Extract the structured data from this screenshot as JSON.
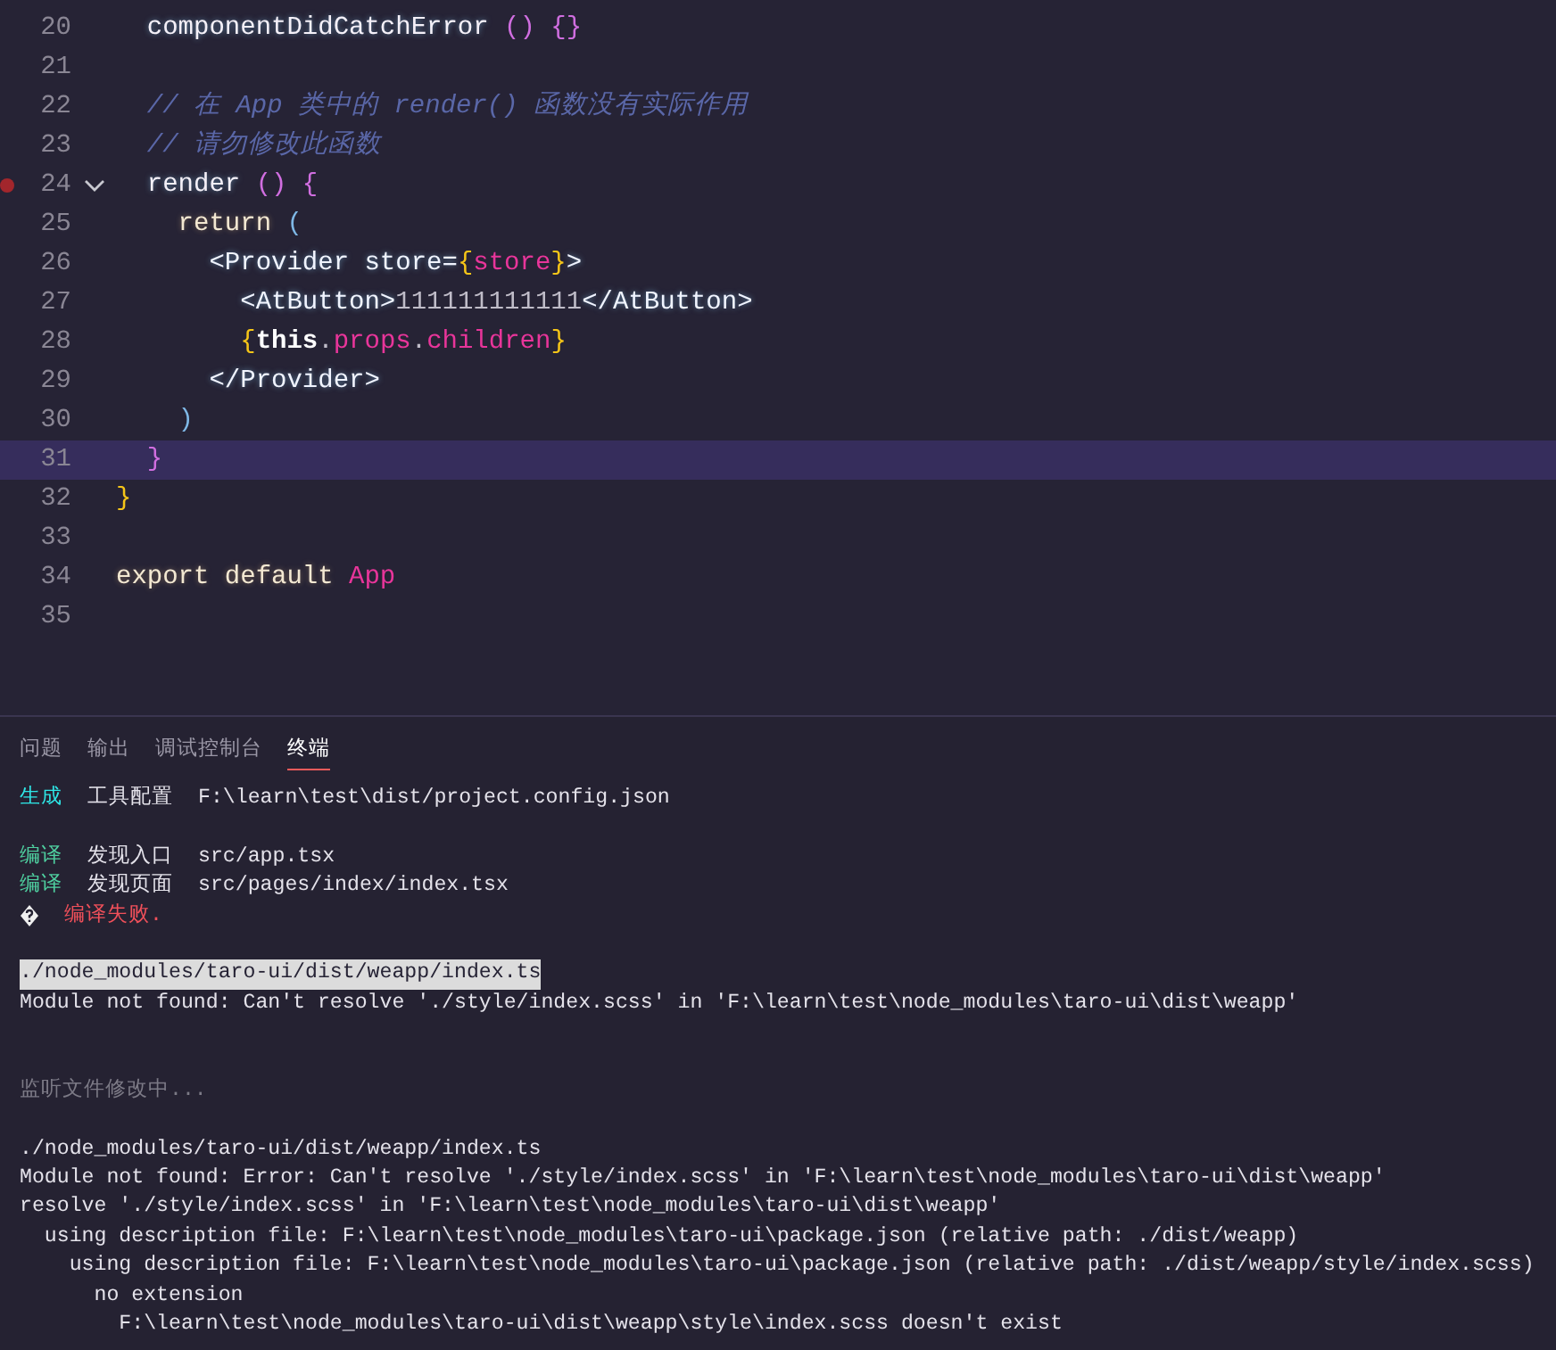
{
  "editor": {
    "lines": [
      {
        "number": "20",
        "breakpoint": false,
        "fold": false,
        "current": false,
        "tokens": [
          {
            "text": "  componentDidCatchError ",
            "kind": "plain"
          },
          {
            "text": "() {}",
            "kind": "paren"
          }
        ]
      },
      {
        "number": "21",
        "breakpoint": false,
        "fold": false,
        "current": false
      },
      {
        "number": "22",
        "breakpoint": false,
        "fold": false,
        "current": false,
        "tokens": [
          {
            "text": "  // 在 App 类中的 render() 函数没有实际作用",
            "kind": "comment"
          }
        ]
      },
      {
        "number": "23",
        "breakpoint": false,
        "fold": false,
        "current": false,
        "tokens": [
          {
            "text": "  // 请勿修改此函数",
            "kind": "comment"
          }
        ]
      },
      {
        "number": "24",
        "breakpoint": true,
        "fold": true,
        "current": false,
        "tokens": [
          {
            "text": "  render ",
            "kind": "plain"
          },
          {
            "text": "() {",
            "kind": "paren"
          }
        ]
      },
      {
        "number": "25",
        "breakpoint": false,
        "fold": false,
        "current": false,
        "tokens": [
          {
            "text": "    return ",
            "kind": "keyword"
          },
          {
            "text": "(",
            "kind": "blue"
          }
        ]
      },
      {
        "number": "26",
        "breakpoint": false,
        "fold": false,
        "current": false,
        "tokens": [
          {
            "text": "      <Provider store=",
            "kind": "tag"
          },
          {
            "text": "{",
            "kind": "brace"
          },
          {
            "text": "store",
            "kind": "prop"
          },
          {
            "text": "}",
            "kind": "brace"
          },
          {
            "text": ">",
            "kind": "tag"
          }
        ]
      },
      {
        "number": "27",
        "breakpoint": false,
        "fold": false,
        "current": false,
        "tokens": [
          {
            "text": "        <AtButton>",
            "kind": "tag"
          },
          {
            "text": "111111111111",
            "kind": "text"
          },
          {
            "text": "</AtButton>",
            "kind": "tag"
          }
        ]
      },
      {
        "number": "28",
        "breakpoint": false,
        "fold": false,
        "current": false,
        "tokens": [
          {
            "text": "        {",
            "kind": "brace"
          },
          {
            "text": "this",
            "kind": "bold"
          },
          {
            "text": ".",
            "kind": "text"
          },
          {
            "text": "props",
            "kind": "prop"
          },
          {
            "text": ".",
            "kind": "text"
          },
          {
            "text": "children",
            "kind": "prop"
          },
          {
            "text": "}",
            "kind": "brace"
          }
        ]
      },
      {
        "number": "29",
        "breakpoint": false,
        "fold": false,
        "current": false,
        "tokens": [
          {
            "text": "      </Provider>",
            "kind": "tag"
          }
        ]
      },
      {
        "number": "30",
        "breakpoint": false,
        "fold": false,
        "current": false,
        "tokens": [
          {
            "text": "    )",
            "kind": "blue"
          }
        ]
      },
      {
        "number": "31",
        "breakpoint": false,
        "fold": false,
        "current": true,
        "tokens": [
          {
            "text": "  }",
            "kind": "paren"
          }
        ]
      },
      {
        "number": "32",
        "breakpoint": false,
        "fold": false,
        "current": false,
        "tokens": [
          {
            "text": "}",
            "kind": "brace"
          }
        ]
      },
      {
        "number": "33",
        "breakpoint": false,
        "fold": false,
        "current": false
      },
      {
        "number": "34",
        "breakpoint": false,
        "fold": false,
        "current": false,
        "tokens": [
          {
            "text": "export default ",
            "kind": "keyword"
          },
          {
            "text": "App",
            "kind": "prop"
          }
        ]
      },
      {
        "number": "35",
        "breakpoint": false,
        "fold": false,
        "current": false
      }
    ]
  },
  "panel": {
    "tabs": [
      {
        "label": "问题",
        "selected": false
      },
      {
        "label": "输出",
        "selected": false
      },
      {
        "label": "调试控制台",
        "selected": false
      },
      {
        "label": "终端",
        "selected": true
      }
    ],
    "terminal": [
      {
        "kind": "line",
        "segments": [
          {
            "text": "生成",
            "kind": "cyan"
          },
          {
            "text": "工具配置",
            "kind": "plain"
          },
          {
            "text": "F:\\learn\\test\\dist/project.config.json",
            "kind": "plain"
          }
        ]
      },
      {
        "kind": "blank"
      },
      {
        "kind": "line",
        "segments": [
          {
            "text": "编译",
            "kind": "green"
          },
          {
            "text": "发现入口",
            "kind": "plain"
          },
          {
            "text": "src/app.tsx",
            "kind": "plain"
          }
        ]
      },
      {
        "kind": "line",
        "segments": [
          {
            "text": "编译",
            "kind": "green"
          },
          {
            "text": "发现页面",
            "kind": "plain"
          },
          {
            "text": "src/pages/index/index.tsx",
            "kind": "plain"
          }
        ]
      },
      {
        "kind": "line",
        "segments": [
          {
            "kind": "glyph"
          },
          {
            "text": "编译失败.",
            "kind": "red"
          }
        ]
      },
      {
        "kind": "blank"
      },
      {
        "kind": "line",
        "segments": [
          {
            "text": "./node_modules/taro-ui/dist/weapp/index.ts",
            "kind": "selected"
          }
        ]
      },
      {
        "kind": "line",
        "segments": [
          {
            "text": "Module not found: Can't resolve './style/index.scss' in 'F:\\learn\\test\\node_modules\\taro-ui\\dist\\weapp'",
            "kind": "plain"
          }
        ]
      },
      {
        "kind": "blank"
      },
      {
        "kind": "blank"
      },
      {
        "kind": "line",
        "segments": [
          {
            "text": "监听文件修改中...",
            "kind": "grey"
          }
        ]
      },
      {
        "kind": "blank"
      },
      {
        "kind": "line",
        "segments": [
          {
            "text": "./node_modules/taro-ui/dist/weapp/index.ts",
            "kind": "plain"
          }
        ]
      },
      {
        "kind": "line",
        "segments": [
          {
            "text": "Module not found: Error: Can't resolve './style/index.scss' in 'F:\\learn\\test\\node_modules\\taro-ui\\dist\\weapp'",
            "kind": "plain"
          }
        ]
      },
      {
        "kind": "line",
        "segments": [
          {
            "text": "resolve './style/index.scss' in 'F:\\learn\\test\\node_modules\\taro-ui\\dist\\weapp'",
            "kind": "plain"
          }
        ]
      },
      {
        "kind": "line",
        "segments": [
          {
            "text": "  using description file: F:\\learn\\test\\node_modules\\taro-ui\\package.json (relative path: ./dist/weapp)",
            "kind": "plain"
          }
        ]
      },
      {
        "kind": "line",
        "segments": [
          {
            "text": "    using description file: F:\\learn\\test\\node_modules\\taro-ui\\package.json (relative path: ./dist/weapp/style/index.scss)",
            "kind": "plain"
          }
        ]
      },
      {
        "kind": "line",
        "segments": [
          {
            "text": "      no extension",
            "kind": "plain"
          }
        ]
      },
      {
        "kind": "line",
        "segments": [
          {
            "text": "        F:\\learn\\test\\node_modules\\taro-ui\\dist\\weapp\\style\\index.scss doesn't exist",
            "kind": "plain"
          }
        ]
      }
    ]
  }
}
